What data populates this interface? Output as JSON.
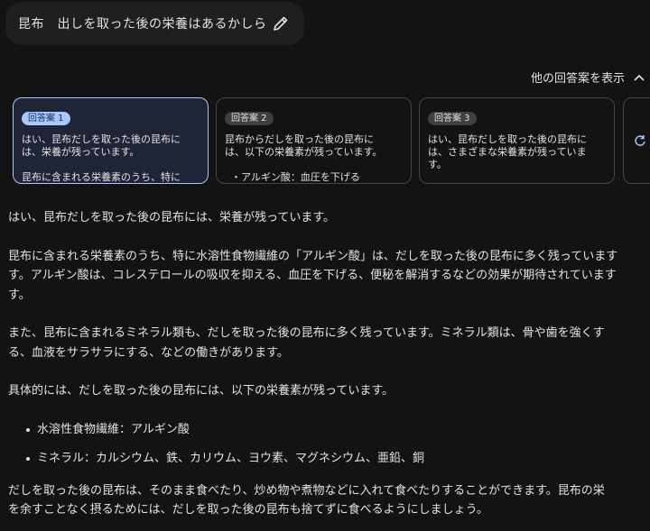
{
  "prompt": {
    "text": "昆布　出しを取った後の栄養はあるかしら"
  },
  "drafts_toggle": {
    "label": "他の回答案を表示"
  },
  "drafts": [
    {
      "badge": "回答案 1",
      "text": "はい、昆布だしを取った後の昆布に\nは、栄養が残っています。",
      "more": "昆布に含まれる栄養素のうち、特に"
    },
    {
      "badge": "回答案 2",
      "text": "昆布からだしを取った後の昆布に\nは、以下の栄養素が残っています。",
      "more": "  ・アルギン酸：血圧を下げる"
    },
    {
      "badge": "回答案 3",
      "text": "はい、昆布だしを取った後の昆布に\nは、さまざまな栄養素が残っていま\nす。",
      "more": ""
    }
  ],
  "answer": {
    "intro": "はい、昆布だしを取った後の昆布には、栄養が残っています。",
    "para1": "昆布に含まれる栄養素のうち、特に水溶性食物繊維の「アルギン酸」は、だしを取った後の昆布に多く残っています\nす。アルギン酸は、コレステロールの吸収を抑える、血圧を下げる、便秘を解消するなどの効果が期待されています\nす。",
    "para2": "また、昆布に含まれるミネラル類も、だしを取った後の昆布に多く残っています。ミネラル類は、骨や歯を強くす\nる、血液をサラサラにする、などの働きがあります。",
    "para3": "具体的には、だしを取った後の昆布には、以下の栄養素が残っています。",
    "items": [
      "水溶性食物繊維：アルギン酸",
      "ミネラル：カルシウム、鉄、カリウム、ヨウ素、マグネシウム、亜鉛、銅"
    ],
    "para4": "だしを取った後の昆布は、そのまま食べたり、炒め物や煮物などに入れて食べたりすることができます。昆布の栄\nを余すことなく摂るためには、だしを取った後の昆布も捨てずに食べるようにしましょう。"
  }
}
